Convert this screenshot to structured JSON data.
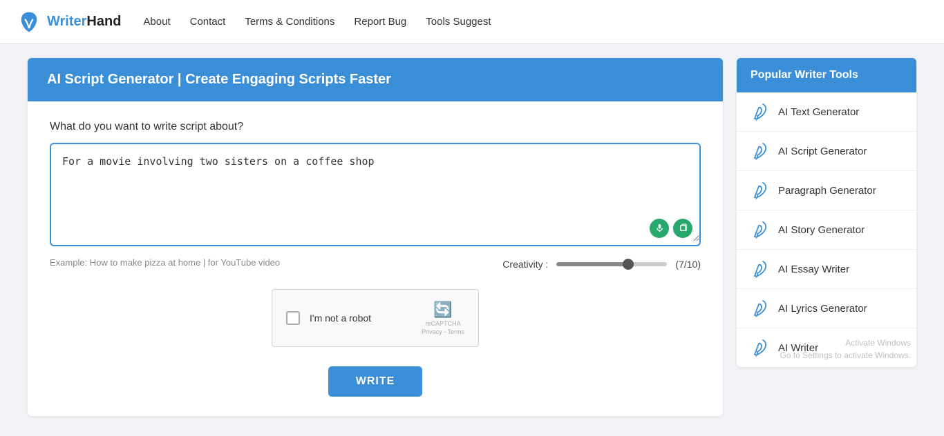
{
  "navbar": {
    "logo_text_writer": "Writer",
    "logo_text_hand": "Hand",
    "nav_items": [
      {
        "label": "About",
        "href": "#"
      },
      {
        "label": "Contact",
        "href": "#"
      },
      {
        "label": "Terms & Conditions",
        "href": "#"
      },
      {
        "label": "Report Bug",
        "href": "#"
      },
      {
        "label": "Tools Suggest",
        "href": "#"
      }
    ]
  },
  "main": {
    "header_title": "AI Script Generator | Create Engaging Scripts Faster",
    "form_label": "What do you want to write script about?",
    "textarea_value": "For a movie involving two sisters on a coffee shop",
    "form_hint": "Example: How to make pizza at home | for YouTube video",
    "creativity_label": "Creativity :",
    "creativity_value": "(7/10)",
    "captcha_label": "I'm not a robot",
    "recaptcha_brand": "reCAPTCHA",
    "recaptcha_links": "Privacy - Terms",
    "write_button": "WRITE"
  },
  "sidebar": {
    "header_title": "Popular Writer Tools",
    "items": [
      {
        "label": "AI Text Generator",
        "icon": "feather"
      },
      {
        "label": "AI Script Generator",
        "icon": "feather"
      },
      {
        "label": "Paragraph Generator",
        "icon": "feather"
      },
      {
        "label": "AI Story Generator",
        "icon": "feather"
      },
      {
        "label": "AI Essay Writer",
        "icon": "feather"
      },
      {
        "label": "AI Lyrics Generator",
        "icon": "feather"
      },
      {
        "label": "AI Writer",
        "icon": "feather"
      }
    ]
  },
  "colors": {
    "brand_blue": "#3a8fd8",
    "green": "#27a96c"
  },
  "activate_windows": {
    "line1": "Activate Windows",
    "line2": "Go to Settings to activate Windows."
  }
}
